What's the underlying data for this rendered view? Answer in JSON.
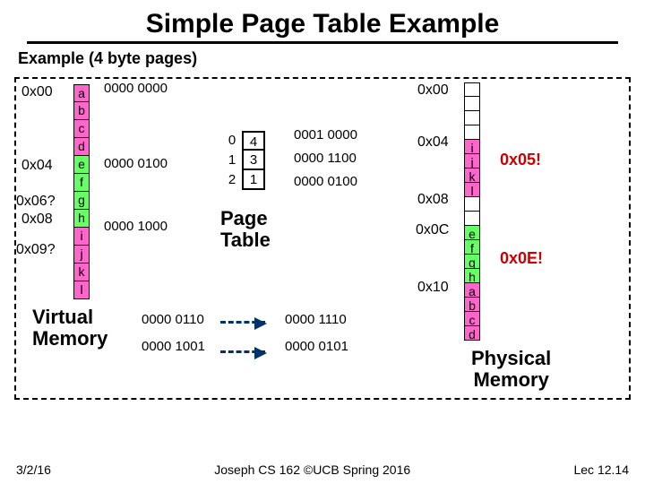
{
  "title": "Simple Page Table Example",
  "subtitle": "Example (4 byte pages)",
  "virtual": {
    "addrs": [
      "0x00",
      "0x04",
      "0x06?",
      "0x08",
      "0x09?"
    ],
    "cells": [
      "a",
      "b",
      "c",
      "d",
      "e",
      "f",
      "g",
      "h",
      "i",
      "j",
      "k",
      "l"
    ],
    "label": "Virtual\nMemory"
  },
  "vbin": [
    "0000 0000",
    "0000 0100",
    "0000 1000"
  ],
  "page_table": {
    "rows": [
      {
        "idx": "0",
        "val": "4",
        "trans": "0001 0000"
      },
      {
        "idx": "1",
        "val": "3",
        "trans": "0000 1100"
      },
      {
        "idx": "2",
        "val": "1",
        "trans": "0000 0100"
      }
    ],
    "label": "Page\nTable"
  },
  "physical": {
    "addrs": [
      "0x00",
      "0x04",
      "0x08",
      "0x0C",
      "0x10"
    ],
    "groups": [
      {
        "color": "white",
        "cells": [
          "",
          "",
          "",
          ""
        ]
      },
      {
        "color": "pink",
        "cells": [
          "i",
          "j",
          "k",
          "l"
        ]
      },
      {
        "color": "white",
        "cells": [
          "",
          "",
          "",
          ""
        ]
      },
      {
        "color": "green",
        "cells": [
          "e",
          "f",
          "g",
          "h"
        ]
      },
      {
        "color": "pink",
        "cells": [
          "a",
          "b",
          "c",
          "d"
        ]
      }
    ],
    "side": [
      "0x05!",
      "0x0E!"
    ],
    "label": "Physical\nMemory"
  },
  "examples": [
    {
      "in": "0000 0110",
      "out": "0000 1110"
    },
    {
      "in": "0000 1001",
      "out": "0000 0101"
    }
  ],
  "footer": {
    "date": "3/2/16",
    "center": "Joseph CS 162 ©UCB Spring 2016",
    "right": "Lec 12.14"
  }
}
